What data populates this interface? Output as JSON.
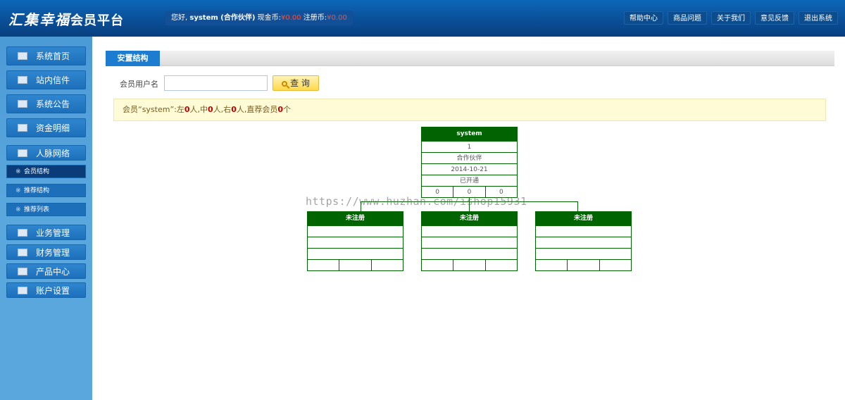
{
  "header": {
    "logo_script": "汇集幸福",
    "logo_suffix": "会员平台",
    "welcome_prefix": "您好,",
    "username": "system (合作伙伴)",
    "cash_label": "现金币:",
    "cash_value": "¥0.00",
    "reg_label": "注册币:",
    "reg_value": "¥0.00",
    "nav": [
      "帮助中心",
      "商品问题",
      "关于我们",
      "意见反馈",
      "退出系统"
    ]
  },
  "sidebar": {
    "items": [
      {
        "label": "系统首页",
        "icon": "home-icon"
      },
      {
        "label": "站内信件",
        "icon": "mail-icon"
      },
      {
        "label": "系统公告",
        "icon": "notice-icon"
      },
      {
        "label": "资金明细",
        "icon": "money-icon"
      },
      {
        "label": "人脉网络",
        "icon": "people-icon"
      }
    ],
    "sub_items": [
      {
        "label": "会员结构",
        "active": true
      },
      {
        "label": "推荐结构",
        "active": false
      },
      {
        "label": "推荐列表",
        "active": false
      }
    ],
    "items_bottom": [
      {
        "label": "业务管理",
        "icon": "business-icon"
      },
      {
        "label": "财务管理",
        "icon": "finance-icon"
      },
      {
        "label": "产品中心",
        "icon": "cart-icon"
      },
      {
        "label": "账户设置",
        "icon": "settings-icon"
      }
    ]
  },
  "tab": {
    "label": "安置结构"
  },
  "search": {
    "label": "会员用户名",
    "value": "",
    "button": "查 询"
  },
  "notice": {
    "part1": "会员“system”:左",
    "left": "0",
    "part2": "人,中",
    "middle": "0",
    "part3": "人,右",
    "right": "0",
    "part4": "人,直荐会员",
    "direct": "0",
    "part5": "个"
  },
  "tree": {
    "root": {
      "name": "system",
      "level": "1",
      "rank": "合作伙伴",
      "date": "2014-10-21",
      "status": "已开通",
      "counts": [
        "0",
        "0",
        "0"
      ]
    },
    "children": [
      {
        "name": "未注册"
      },
      {
        "name": "未注册"
      },
      {
        "name": "未注册"
      }
    ]
  },
  "watermark": "https://www.huzhan.com/ishop15931",
  "colors": {
    "node_green": "#006400",
    "accent_blue": "#1c7dd0",
    "money_red": "#ff4a2e"
  }
}
